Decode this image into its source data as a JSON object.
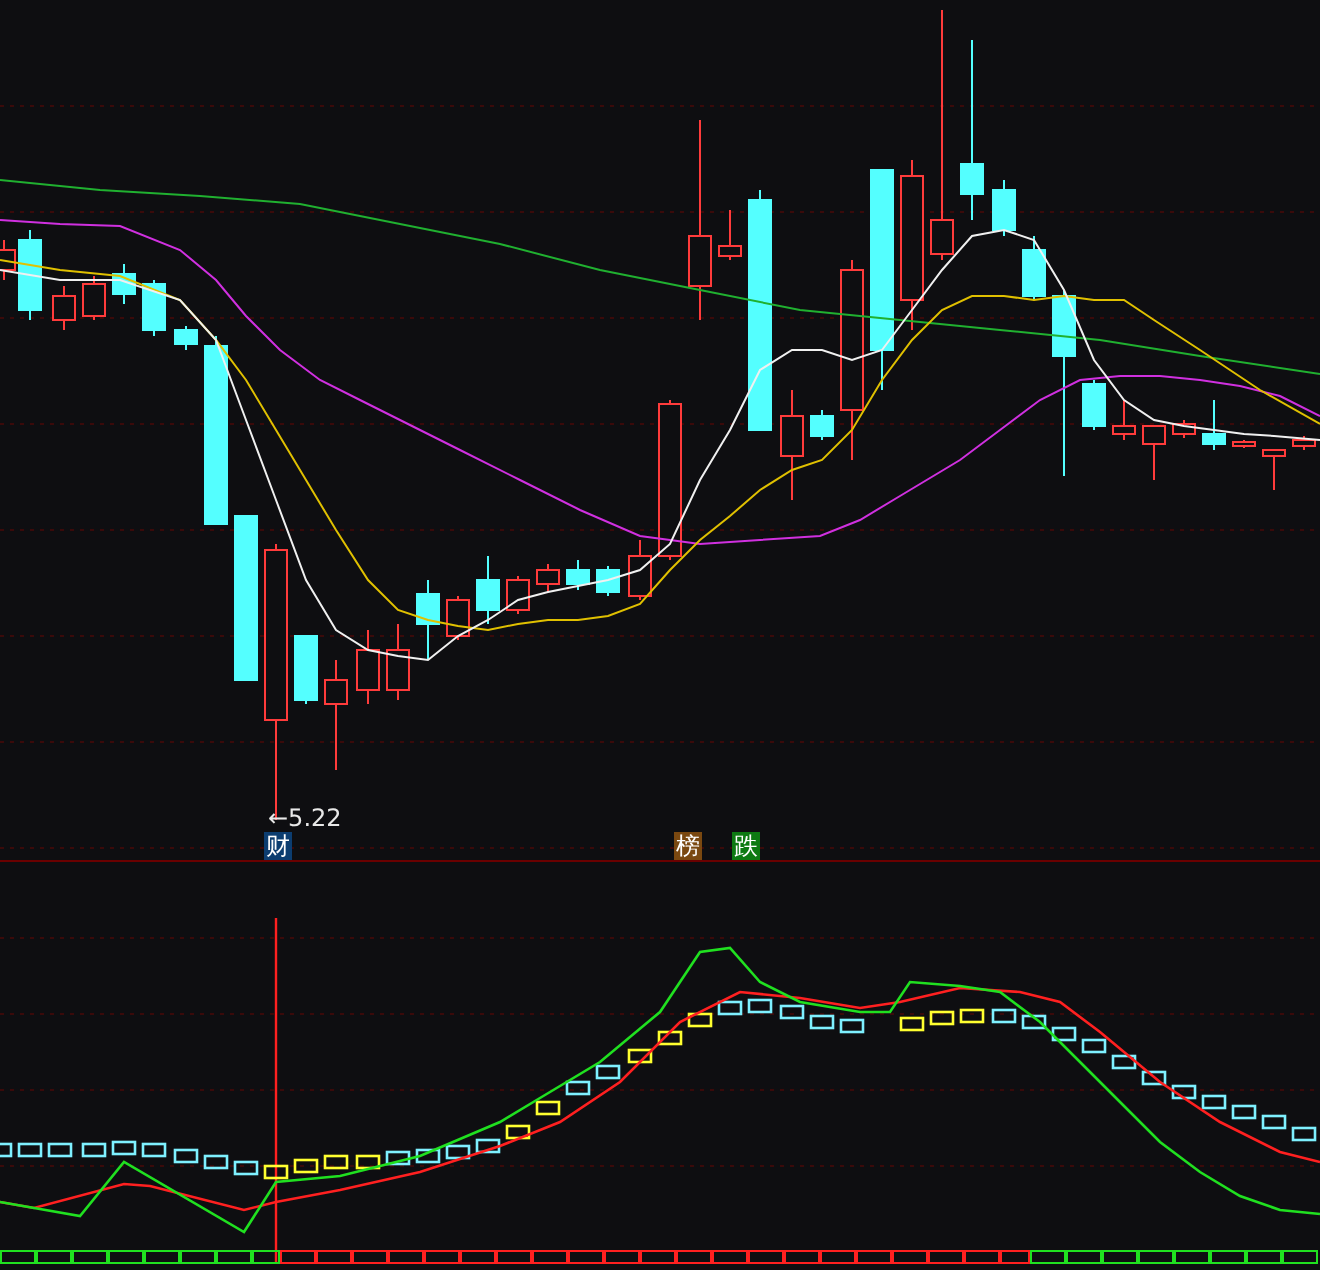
{
  "price_chart": {
    "low_marker": {
      "label": "←5.22"
    },
    "event_badges": [
      {
        "label": "财",
        "color": "#0c3d70"
      },
      {
        "label": "榜",
        "color": "#7a4810"
      },
      {
        "label": "跌",
        "color": "#0d7a12"
      }
    ]
  }
}
